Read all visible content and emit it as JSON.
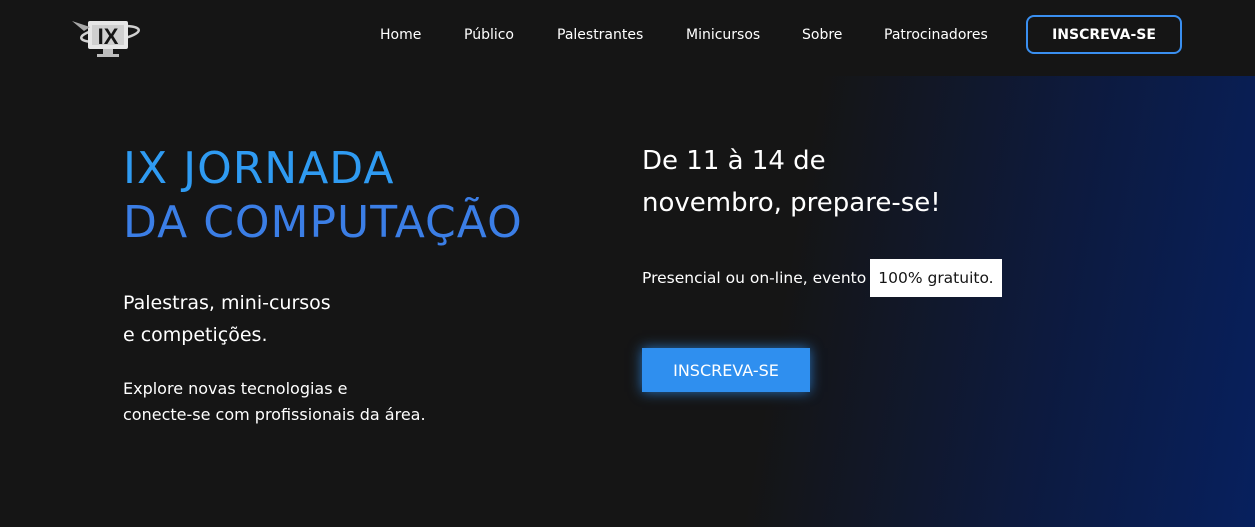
{
  "navbar": {
    "logo_text": "IX",
    "links": [
      "Home",
      "Público",
      "Palestrantes",
      "Minicursos",
      "Sobre",
      "Patrocinadores"
    ],
    "cta_label": "INSCREVA-SE"
  },
  "hero": {
    "title_line1": "IX JORNADA",
    "title_line2": "DA COMPUTAÇÃO",
    "subtitle_line1": "Palestras, mini-cursos",
    "subtitle_line2": "e competições.",
    "description_line1": "Explore novas tecnologias e",
    "description_line2": "conecte-se com profissionais da área.",
    "dates_line1": "De 11 à 14 de",
    "dates_line2": "novembro, prepare-se!",
    "format_text": "Presencial ou on-line, evento",
    "free_badge": "100% gratuito.",
    "cta_label": "INSCREVA-SE"
  },
  "colors": {
    "background": "#151515",
    "accent_blue": "#2f9bf2",
    "title_blue_2": "#3b7ee6",
    "button_blue": "#2f8fef",
    "gradient_navy": "#07205e"
  },
  "icons": {
    "logo": "ix-monitor-logo-icon"
  }
}
